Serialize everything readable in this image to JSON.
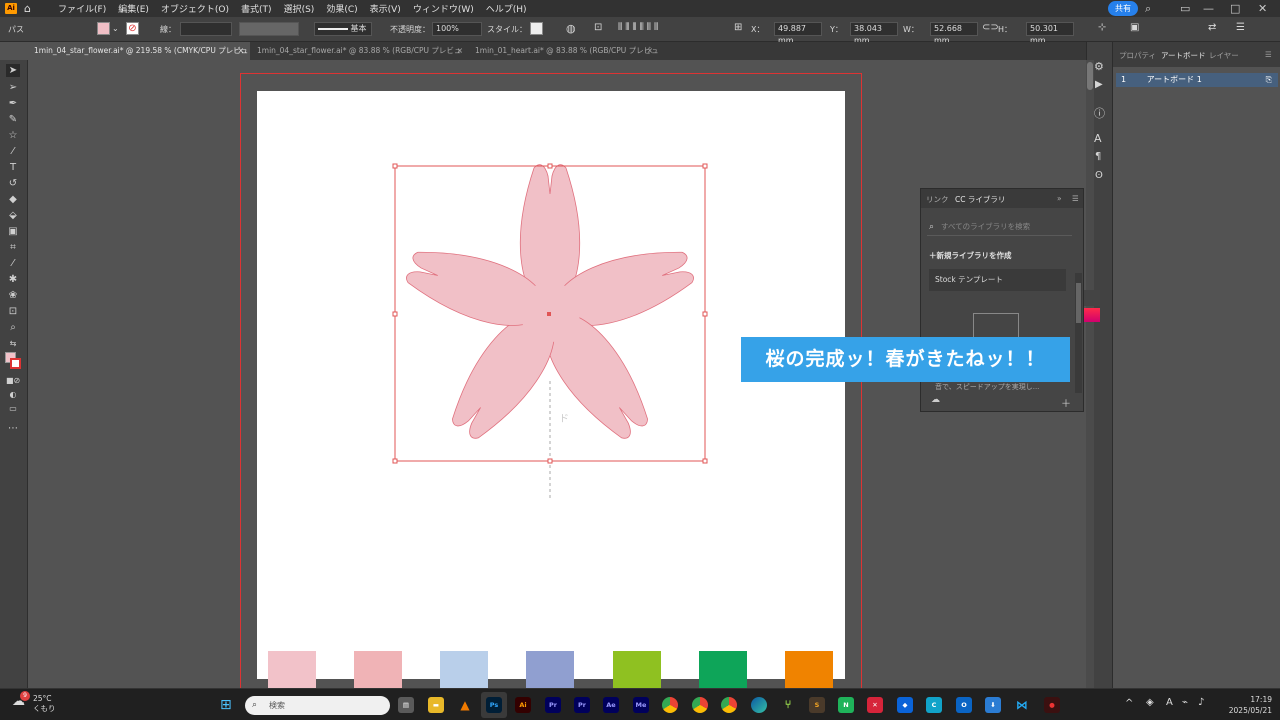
{
  "menubar": {
    "logo": "Ai",
    "menus": [
      "ファイル(F)",
      "編集(E)",
      "オブジェクト(O)",
      "書式(T)",
      "選択(S)",
      "効果(C)",
      "表示(V)",
      "ウィンドウ(W)",
      "ヘルプ(H)"
    ],
    "share_label": "共有"
  },
  "control_bar": {
    "object_type": "パス",
    "stroke_label": "線：",
    "stroke_style": "基本",
    "opacity_label": "不透明度：",
    "opacity_value": "100%",
    "style_label": "スタイル：",
    "x_label": "X：",
    "x_value": "49.887 mm",
    "y_label": "Y：",
    "y_value": "38.043 mm",
    "w_label": "W：",
    "w_value": "52.668 mm",
    "h_label": "H：",
    "h_value": "50.301 mm",
    "fill_color": "#f0bfc6"
  },
  "tabs": [
    {
      "label": "1min_04_star_flower.ai* @ 219.58 % (CMYK/CPU プレビュー)",
      "close": "×"
    },
    {
      "label": "1min_04_star_flower.ai* @ 83.88 % (RGB/CPU プレビュー)",
      "close": "×"
    },
    {
      "label": "1min_01_heart.ai* @ 83.88 % (RGB/CPU プレビュー)",
      "close": "×"
    }
  ],
  "canvas": {
    "flower_fill": "#f1c0c7",
    "flower_stroke": "#e0707e",
    "faint_label": "ド",
    "swatches": [
      "#f2c2c9",
      "#f0b3b6",
      "#b9cfea",
      "#909fd0",
      "#8fc121",
      "#0ea559",
      "#f08300"
    ]
  },
  "right_panel": {
    "tabs": [
      "プロパティ",
      "アートボード",
      "レイヤー"
    ],
    "artboard_row": {
      "index": "1",
      "name": "アートボード 1"
    }
  },
  "library_panel": {
    "tabs": [
      "リンク",
      "CC ライブラリ"
    ],
    "search_placeholder": "すべてのライブラリを検索",
    "new_library": "新規ライブラリを作成",
    "stock_template": "Stock テンプレート",
    "description": "音で、スピードアップを実現し..."
  },
  "caption": "桜の完成ッ！春がきたねッ！！",
  "taskbar": {
    "temperature": "25°C",
    "condition": "くもり",
    "badge": "9",
    "search_placeholder": "検索",
    "time": "17:19",
    "date": "2025/05/21",
    "apps": [
      {
        "name": "Ps",
        "color": "#001e36",
        "fg": "#31a8ff"
      },
      {
        "name": "Ai",
        "color": "#330000",
        "fg": "#ff9a00"
      },
      {
        "name": "Pr",
        "color": "#00005b",
        "fg": "#9999ff"
      },
      {
        "name": "Pr",
        "color": "#00005b",
        "fg": "#9999ff"
      },
      {
        "name": "Ae",
        "color": "#00005b",
        "fg": "#9999ff"
      },
      {
        "name": "Me",
        "color": "#00005b",
        "fg": "#9999ff"
      }
    ]
  }
}
